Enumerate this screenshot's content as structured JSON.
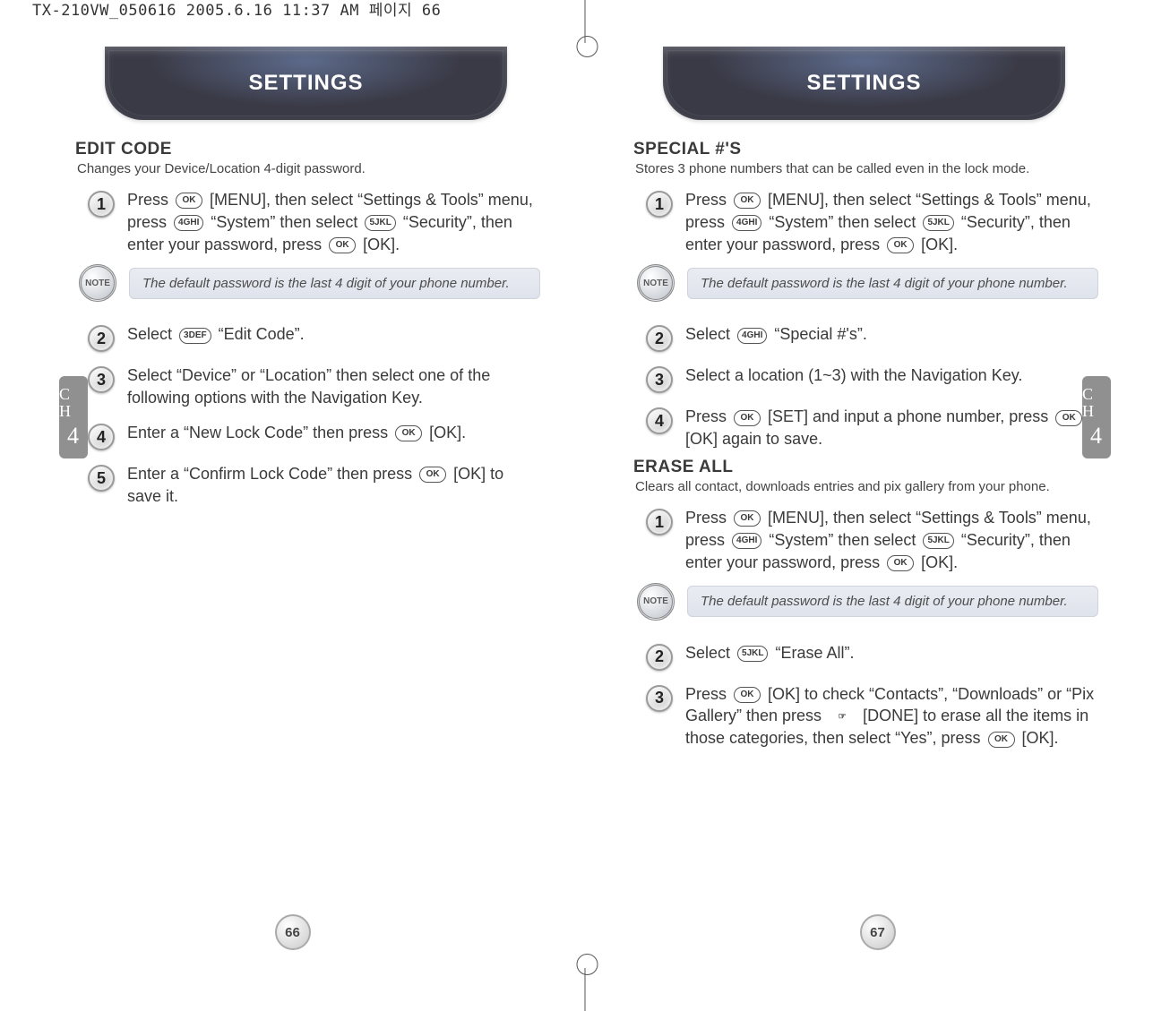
{
  "doc_header": "TX-210VW_050616  2005.6.16  11:37 AM  페이지 66",
  "note_badge": "NOTE",
  "ok_key": "OK",
  "left": {
    "pill_title": "SETTINGS",
    "page_number": "66",
    "ch_label_top": "C\nH",
    "ch_label_num": "4",
    "sections": [
      {
        "title": "EDIT CODE",
        "subtitle": "Changes your Device/Location 4-digit password.",
        "steps": [
          {
            "n": "1",
            "text_parts": [
              "Press ",
              {
                "key": "OK"
              },
              " [MENU], then select “Settings & Tools” menu, press ",
              {
                "key": "4GHI"
              },
              " “System” then select ",
              {
                "key": "5JKL"
              },
              " “Security”, then enter your password, press ",
              {
                "key": "OK"
              },
              " [OK]."
            ]
          },
          {
            "note": "The default password is the last 4 digit of your phone number."
          },
          {
            "n": "2",
            "text_parts": [
              "Select ",
              {
                "key": "3DEF"
              },
              " “Edit Code”."
            ]
          },
          {
            "n": "3",
            "text_parts": [
              "Select “Device” or “Location” then select one of the following options with the Navigation Key."
            ]
          },
          {
            "n": "4",
            "text_parts": [
              "Enter a “New Lock Code” then press ",
              {
                "key": "OK"
              },
              " [OK]."
            ]
          },
          {
            "n": "5",
            "text_parts": [
              "Enter a “Confirm Lock Code” then press ",
              {
                "key": "OK"
              },
              " [OK] to save it."
            ]
          }
        ]
      }
    ]
  },
  "right": {
    "pill_title": "SETTINGS",
    "page_number": "67",
    "ch_label_top": "C\nH",
    "ch_label_num": "4",
    "sections": [
      {
        "title": "SPECIAL #'S",
        "subtitle": "Stores 3 phone numbers that can be called even in the lock mode.",
        "steps": [
          {
            "n": "1",
            "text_parts": [
              "Press ",
              {
                "key": "OK"
              },
              " [MENU], then select “Settings & Tools” menu, press ",
              {
                "key": "4GHI"
              },
              " “System” then select ",
              {
                "key": "5JKL"
              },
              " “Security”, then enter your password, press ",
              {
                "key": "OK"
              },
              " [OK]."
            ]
          },
          {
            "note": "The default password is the last 4 digit of your phone number."
          },
          {
            "n": "2",
            "text_parts": [
              "Select ",
              {
                "key": "4GHI"
              },
              " “Special #'s”."
            ]
          },
          {
            "n": "3",
            "text_parts": [
              "Select a location (1~3) with the Navigation Key."
            ]
          },
          {
            "n": "4",
            "text_parts": [
              "Press ",
              {
                "key": "OK"
              },
              " [SET] and input a phone number, press ",
              {
                "key": "OK"
              },
              " [OK] again to save."
            ]
          }
        ]
      },
      {
        "title": "ERASE ALL",
        "subtitle": "Clears all contact, downloads entries and pix gallery from your phone.",
        "steps": [
          {
            "n": "1",
            "text_parts": [
              "Press ",
              {
                "key": "OK"
              },
              " [MENU], then select “Settings & Tools” menu, press ",
              {
                "key": "4GHI"
              },
              " “System” then select ",
              {
                "key": "5JKL"
              },
              " “Security”, then enter your password, press ",
              {
                "key": "OK"
              },
              " [OK]."
            ]
          },
          {
            "note": "The default password is the last 4 digit of your phone number."
          },
          {
            "n": "2",
            "text_parts": [
              "Select ",
              {
                "key": "5JKL"
              },
              " “Erase All”."
            ]
          },
          {
            "n": "3",
            "text_parts": [
              "Press ",
              {
                "key": "OK"
              },
              " [OK] to check “Contacts”, “Downloads” or “Pix Gallery” then press ",
              {
                "key": "HAND"
              },
              " [DONE] to erase all the items in those categories, then select “Yes”, press ",
              {
                "key": "OK"
              },
              " [OK]."
            ]
          }
        ]
      }
    ]
  }
}
